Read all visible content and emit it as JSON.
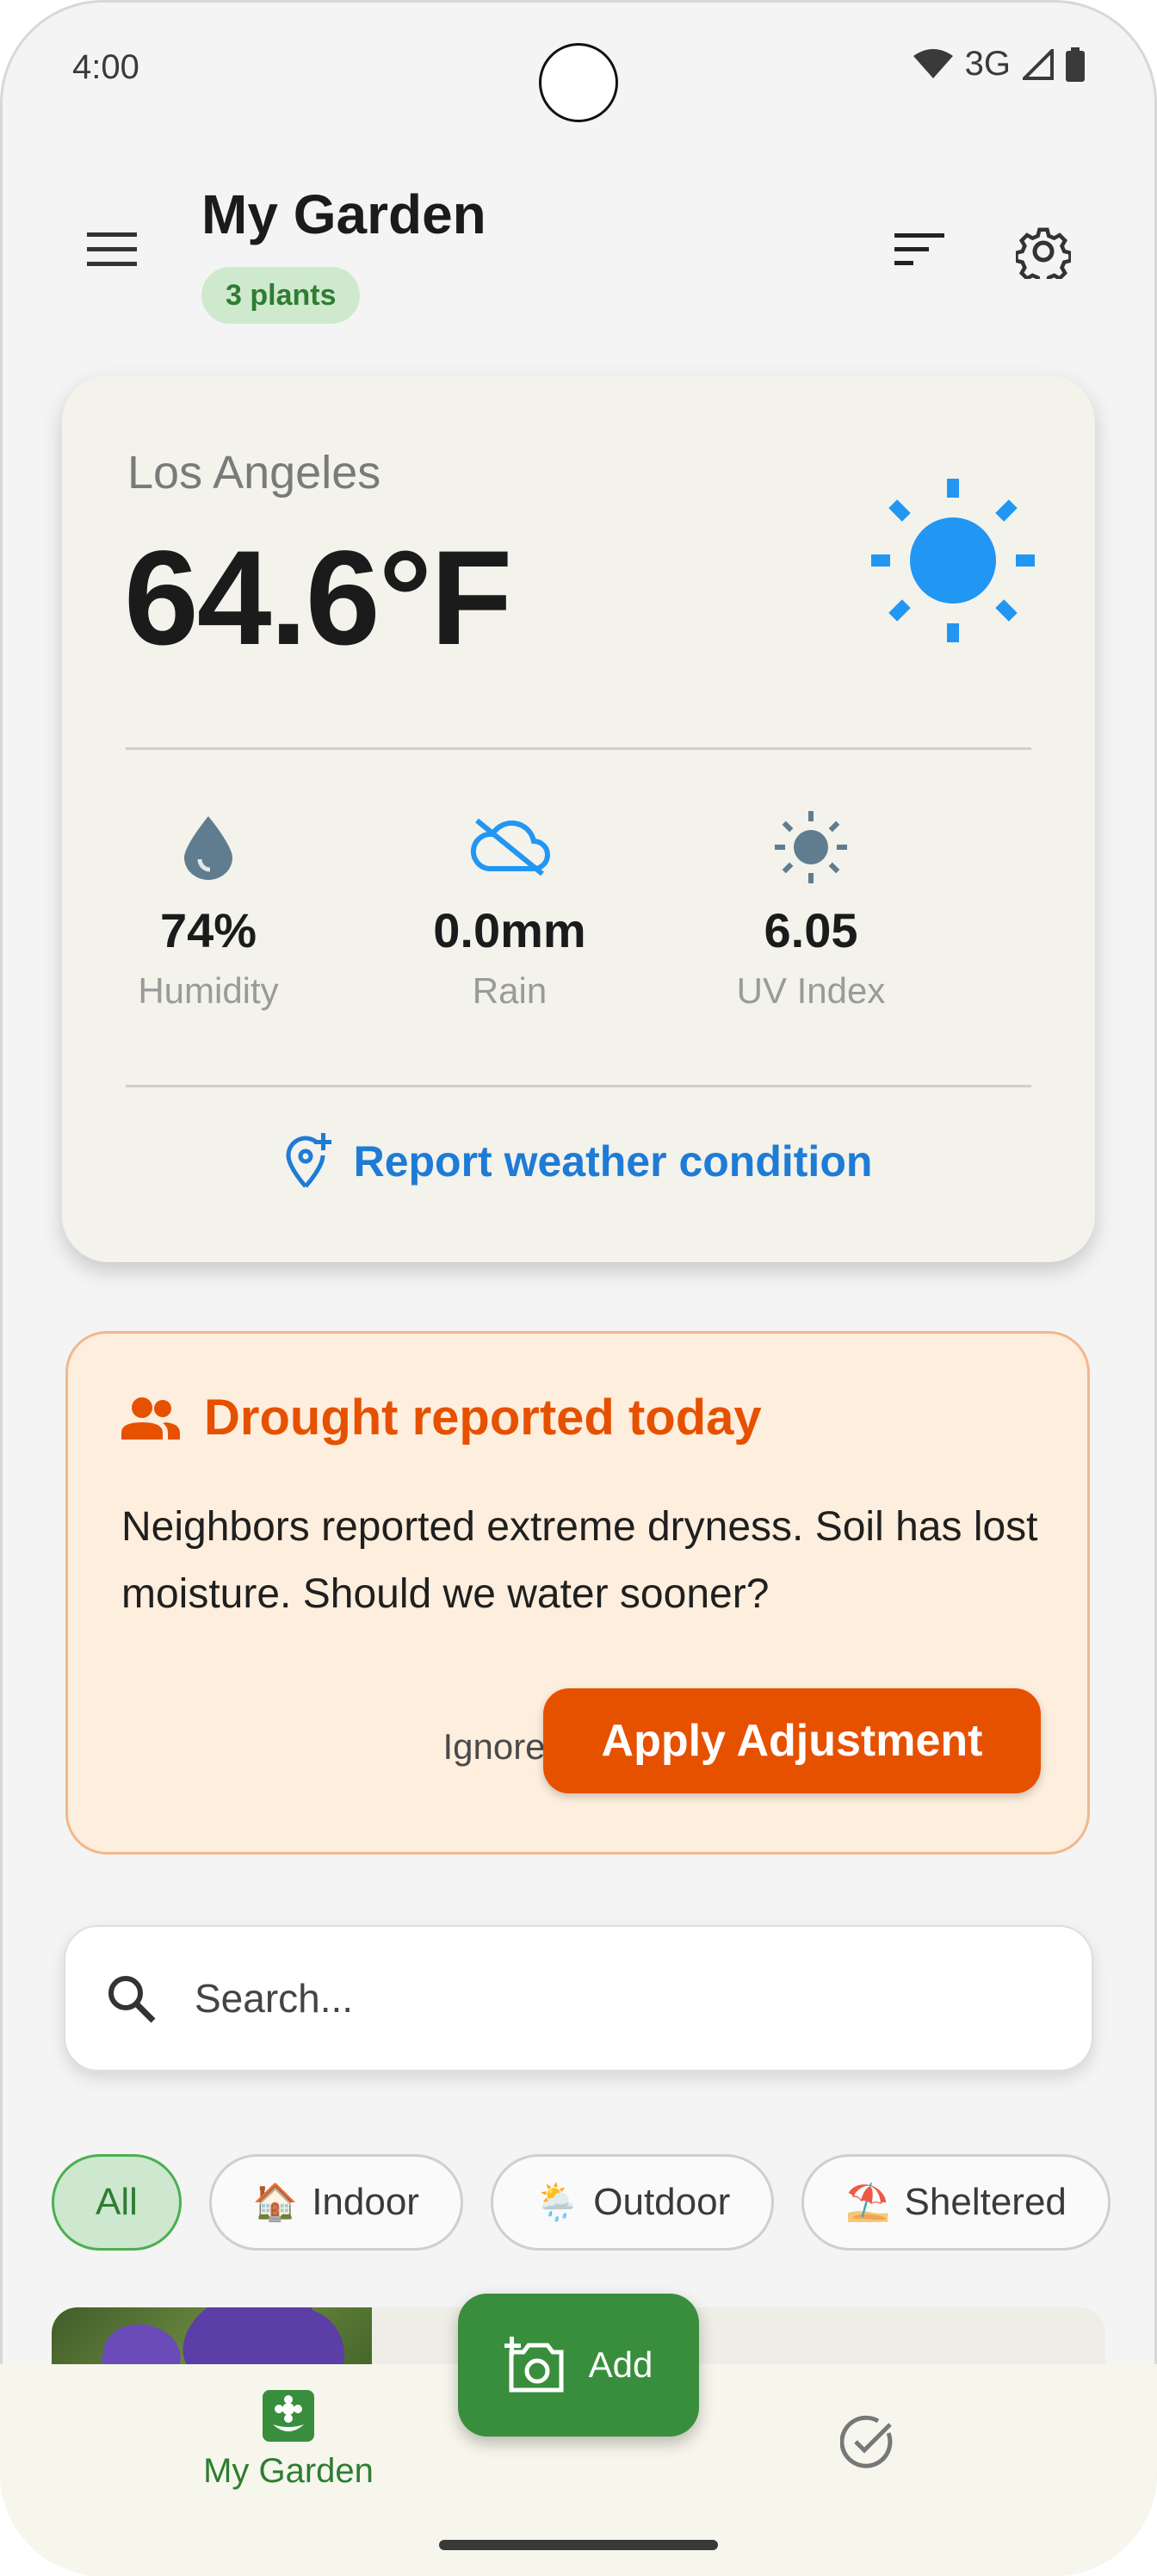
{
  "status_bar": {
    "time": "4:00",
    "network": "3G"
  },
  "header": {
    "title": "My Garden",
    "badge": "3 plants"
  },
  "weather": {
    "city": "Los Angeles",
    "temperature": "64.6°F",
    "condition_icon": "sun-icon",
    "stats": [
      {
        "value": "74%",
        "label": "Humidity",
        "icon": "water-drop-icon"
      },
      {
        "value": "0.0mm",
        "label": "Rain",
        "icon": "cloud-off-icon"
      },
      {
        "value": "6.05",
        "label": "UV Index",
        "icon": "uv-sun-icon"
      }
    ],
    "report_link": "Report weather condition"
  },
  "alert": {
    "title": "Drought reported today",
    "body": "Neighbors reported extreme dryness. Soil has lost moisture. Should we water sooner?",
    "ignore_label": "Ignore",
    "apply_label": "Apply Adjustment"
  },
  "search": {
    "placeholder": "Search..."
  },
  "filters": [
    {
      "label": "All",
      "emoji": "",
      "active": true
    },
    {
      "label": "Indoor",
      "emoji": "🏠",
      "active": false
    },
    {
      "label": "Outdoor",
      "emoji": "🌦️",
      "active": false
    },
    {
      "label": "Sheltered",
      "emoji": "⛱️",
      "active": false
    }
  ],
  "fab": {
    "label": "Add"
  },
  "nav": {
    "garden_label": "My Garden"
  },
  "colors": {
    "accent": "#388e3c",
    "alert": "#e65100",
    "link": "#1e7bd6",
    "sun": "#2196f3"
  }
}
